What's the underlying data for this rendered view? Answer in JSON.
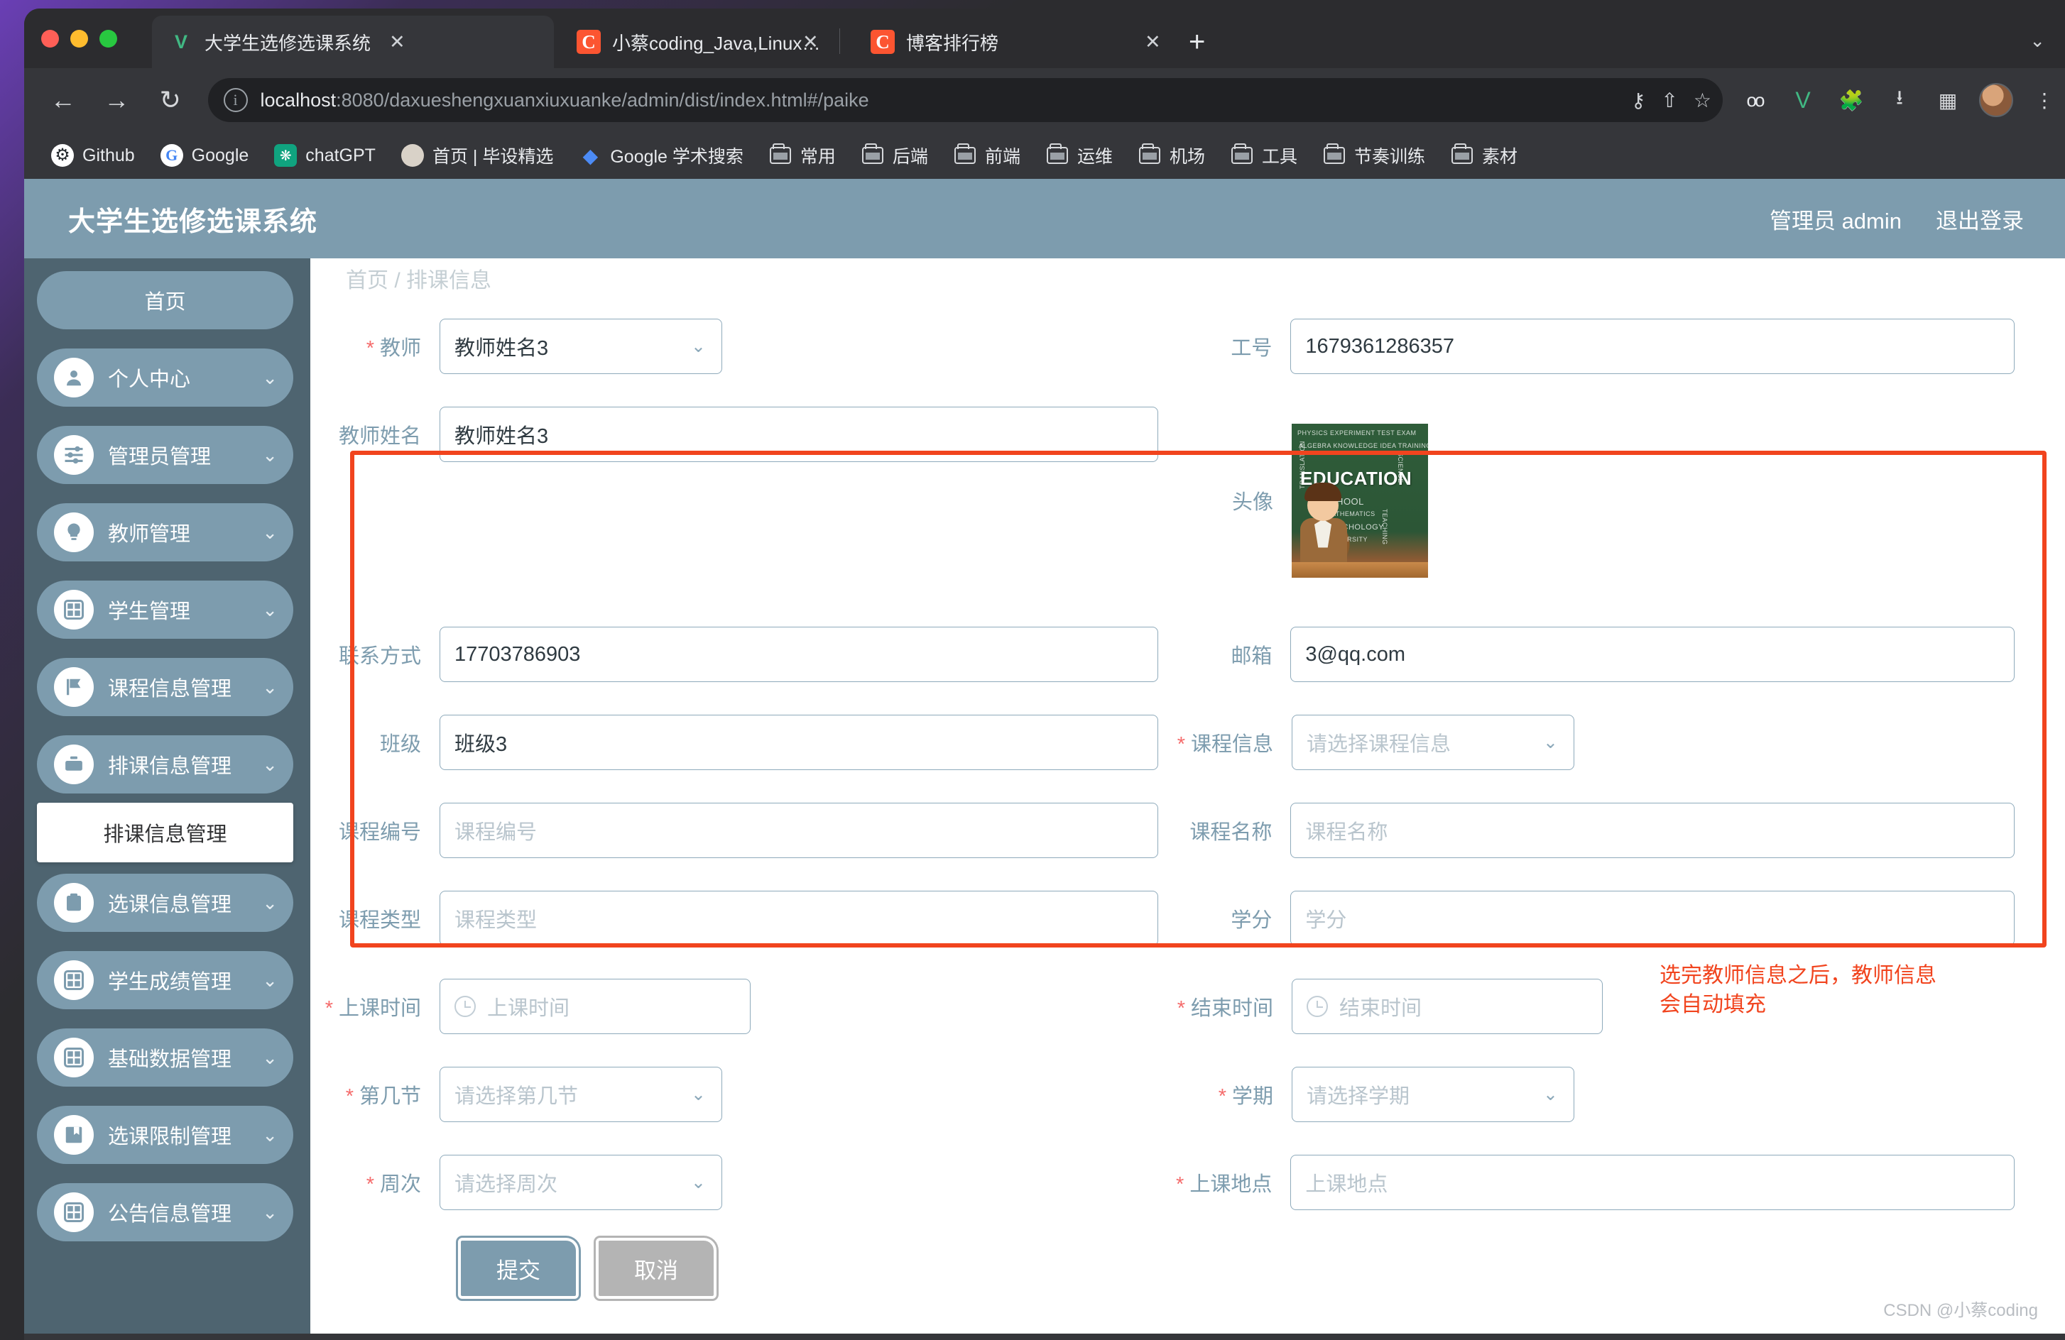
{
  "browser": {
    "tabs": [
      {
        "title": "大学生选修选课系统",
        "favicon": "vue-icon",
        "active": true,
        "close": "✕"
      },
      {
        "title": "小蔡coding_Java,Linux,前端-CS",
        "favicon": "csdn-icon",
        "active": false,
        "close": "✕"
      },
      {
        "title": "博客排行榜",
        "favicon": "csdn-icon",
        "active": false,
        "close": "✕"
      }
    ],
    "new_tab": "+",
    "tab_list_chevron": "⌄",
    "nav": {
      "back": "←",
      "forward": "→",
      "reload": "↻"
    },
    "omnibox": {
      "info_icon": "ⓘ",
      "host": "localhost",
      "path": ":8080/daxueshengxuanxiuxuanke/admin/dist/index.html#/paike",
      "key_icon": "⚷",
      "share_icon": "⇧",
      "star_icon": "☆"
    },
    "toolbar_icons": [
      "opera-extension-icon",
      "vue-devtools-icon",
      "puzzle-extension-icon",
      "download-icon",
      "sidepanel-icon",
      "profile-avatar",
      "overflow-menu-icon"
    ],
    "bookmarks": [
      {
        "label": "Github",
        "icon": "github-icon"
      },
      {
        "label": "Google",
        "icon": "google-icon"
      },
      {
        "label": "chatGPT",
        "icon": "chatgpt-icon"
      },
      {
        "label": "首页 | 毕设精选",
        "icon": "person-icon"
      },
      {
        "label": "Google 学术搜索",
        "icon": "google-scholar-icon"
      },
      {
        "label": "常用",
        "icon": "folder-icon"
      },
      {
        "label": "后端",
        "icon": "folder-icon"
      },
      {
        "label": "前端",
        "icon": "folder-icon"
      },
      {
        "label": "运维",
        "icon": "folder-icon"
      },
      {
        "label": "机场",
        "icon": "folder-icon"
      },
      {
        "label": "工具",
        "icon": "folder-icon"
      },
      {
        "label": "节奏训练",
        "icon": "folder-icon"
      },
      {
        "label": "素材",
        "icon": "folder-icon"
      }
    ]
  },
  "app": {
    "title": "大学生选修选课系统",
    "user_label": "管理员 admin",
    "logout_label": "退出登录",
    "breadcrumb": "首页 / 排课信息",
    "sidebar": {
      "home_label": "首页",
      "items": [
        {
          "label": "个人中心",
          "icon": "user-icon",
          "caret": "⌄"
        },
        {
          "label": "管理员管理",
          "icon": "sliders-icon",
          "caret": "⌄"
        },
        {
          "label": "教师管理",
          "icon": "bulb-icon",
          "caret": "⌄"
        },
        {
          "label": "学生管理",
          "icon": "grid-icon",
          "caret": "⌄"
        },
        {
          "label": "课程信息管理",
          "icon": "flag-icon",
          "caret": "⌄"
        },
        {
          "label": "排课信息管理",
          "icon": "briefcase-icon",
          "caret": "⌄"
        },
        {
          "label": "选课信息管理",
          "icon": "clipboard-x-icon",
          "caret": "⌄"
        },
        {
          "label": "学生成绩管理",
          "icon": "grid-icon",
          "caret": "⌄"
        },
        {
          "label": "基础数据管理",
          "icon": "grid-icon",
          "caret": "⌄"
        },
        {
          "label": "选课限制管理",
          "icon": "book-icon",
          "caret": "⌄"
        },
        {
          "label": "公告信息管理",
          "icon": "grid-icon",
          "caret": "⌄"
        }
      ],
      "active_submenu": "排课信息管理"
    },
    "form": {
      "teacher": {
        "label": "教师",
        "required": true,
        "value": "教师姓名3",
        "caret": "⌄"
      },
      "job_number": {
        "label": "工号",
        "required": false,
        "value": "1679361286357"
      },
      "teacher_name": {
        "label": "教师姓名",
        "required": false,
        "value": "教师姓名3"
      },
      "avatar": {
        "label": "头像",
        "required": false,
        "image_alt": "EDUCATION"
      },
      "contact": {
        "label": "联系方式",
        "required": false,
        "value": "17703786903"
      },
      "email": {
        "label": "邮箱",
        "required": false,
        "value": "3@qq.com"
      },
      "class": {
        "label": "班级",
        "required": false,
        "value": "班级3"
      },
      "course_info": {
        "label": "课程信息",
        "required": true,
        "placeholder": "请选择课程信息",
        "caret": "⌄"
      },
      "course_number": {
        "label": "课程编号",
        "required": false,
        "placeholder": "课程编号"
      },
      "course_name": {
        "label": "课程名称",
        "required": false,
        "placeholder": "课程名称"
      },
      "course_type": {
        "label": "课程类型",
        "required": false,
        "placeholder": "课程类型"
      },
      "credits": {
        "label": "学分",
        "required": false,
        "placeholder": "学分"
      },
      "start_time": {
        "label": "上课时间",
        "required": true,
        "placeholder": "上课时间",
        "icon": "clock-icon"
      },
      "end_time": {
        "label": "结束时间",
        "required": true,
        "placeholder": "结束时间",
        "icon": "clock-icon"
      },
      "period": {
        "label": "第几节",
        "required": true,
        "placeholder": "请选择第几节",
        "caret": "⌄"
      },
      "semester": {
        "label": "学期",
        "required": true,
        "placeholder": "请选择学期",
        "caret": "⌄"
      },
      "week": {
        "label": "周次",
        "required": true,
        "placeholder": "请选择周次",
        "caret": "⌄"
      },
      "location": {
        "label": "上课地点",
        "required": true,
        "placeholder": "上课地点"
      },
      "submit_label": "提交",
      "cancel_label": "取消"
    },
    "annotation": "选完教师信息之后，教师信息\n会自动填充",
    "watermark": "CSDN @小蔡coding",
    "colors": {
      "brand": "#7d9cae",
      "sidebar": "#4e6470",
      "annotation": "#f1441e",
      "required_star": "#f56c6c",
      "cancel": "#b4b4b4"
    }
  }
}
